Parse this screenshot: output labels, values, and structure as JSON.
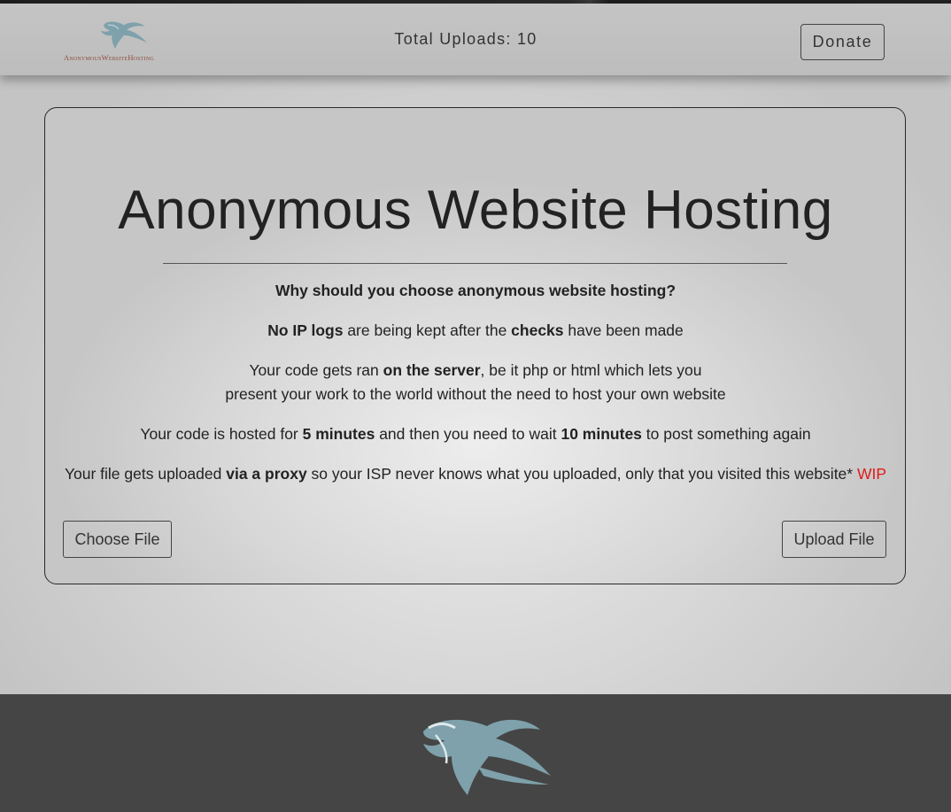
{
  "header": {
    "logo_text": "AnonymousWebsiteHosting",
    "total_uploads": "Total Uploads: 10",
    "donate_label": "Donate"
  },
  "main": {
    "title": "Anonymous Website Hosting",
    "question": "Why should you choose anonymous website hosting?",
    "p1": {
      "b1": "No IP logs",
      "t1": " are being kept after the ",
      "b2": "checks",
      "t2": " have been made"
    },
    "p2": {
      "t1": "Your code gets ran ",
      "b1": "on the server",
      "t2": ", be it php or html which lets you",
      "line2": "present your work to the world without the need to host your own website"
    },
    "p3": {
      "t1": "Your code is hosted for ",
      "b1": "5 minutes",
      "t2": " and then you need to wait ",
      "b2": "10 minutes",
      "t3": " to post something again"
    },
    "p4": {
      "t1": "Your file gets uploaded ",
      "b1": "via a proxy",
      "t2": " so your ISP never knows what you uploaded, only that you visited this website* ",
      "wip": "WIP"
    },
    "choose_file_label": "Choose File",
    "upload_file_label": "Upload File"
  },
  "icons": {
    "logo": "swallow-bird-icon"
  },
  "colors": {
    "bird": "#7ea1ab",
    "wip": "#e01b1b",
    "footer": "#454545"
  }
}
